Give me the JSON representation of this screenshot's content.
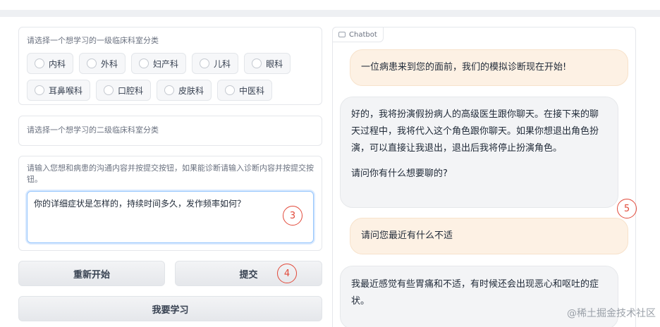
{
  "dept_level1": {
    "label": "请选择一个想学习的一级临床科室分类",
    "options_row1": [
      "内科",
      "外科",
      "妇产科",
      "儿科",
      "眼科"
    ],
    "options_row2": [
      "耳鼻喉科",
      "口腔科",
      "皮肤科",
      "中医科"
    ]
  },
  "dept_level2": {
    "placeholder": "请选择一个想学习的二级临床科室分类"
  },
  "input": {
    "label": "请输入您想和病患的沟通内容并按提交按钮，如果能诊断请输入诊断内容并按提交按钮。",
    "value": "你的详细症状是怎样的，持续时间多久，发作频率如何？"
  },
  "buttons": {
    "restart": "重新开始",
    "submit": "提交",
    "learn": "我要学习"
  },
  "markers": {
    "m3": "3",
    "m4": "4",
    "m5": "5"
  },
  "chatbot": {
    "tag": "Chatbot",
    "messages": [
      {
        "role": "user",
        "text": "一位病患来到您的面前，我们的模拟诊断现在开始!"
      },
      {
        "role": "bot",
        "paragraphs": [
          "好的，我将扮演假扮病人的高级医生跟你聊天。在接下来的聊天过程中，我将代入这个角色跟你聊天。如果你想退出角色扮演，可以直接让我退出，退出后我将停止扮演角色。",
          "请问你有什么想要聊的?"
        ]
      },
      {
        "role": "user",
        "text": "请问您最近有什么不适"
      },
      {
        "role": "bot",
        "paragraphs": [
          "我最近感觉有些胃痛和不适，有时候还会出现恶心和呕吐的症状。"
        ]
      }
    ]
  },
  "watermark": "@稀土掘金技术社区"
}
